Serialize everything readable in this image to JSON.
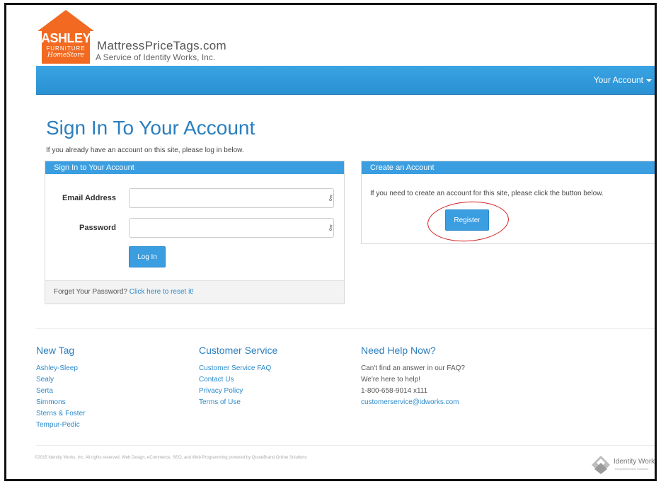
{
  "header": {
    "logo_main": "ASHLEY",
    "logo_sub": "FURNITURE",
    "logo_home": "HomeStore",
    "site_name": "MattressPriceTags.com",
    "site_tagline": "A Service of Identity Works, Inc."
  },
  "navbar": {
    "account_label": "Your Account",
    "color": "#3aa4e3"
  },
  "page": {
    "title": "Sign In To Your Account",
    "intro": "If you already have an account on this site, please log in below."
  },
  "sign_in_panel": {
    "heading": "Sign In to Your Account",
    "email_label": "Email Address",
    "email_value": "",
    "password_label": "Password",
    "password_value": "",
    "login_label": "Log In",
    "forgot_text": "Forget Your Password?",
    "forgot_link": "Click here to reset it!"
  },
  "create_panel": {
    "heading": "Create an Account",
    "text": "If you need to create an account for this site, please click the button below.",
    "register_label": "Register"
  },
  "footer": {
    "col1": {
      "heading": "New Tag",
      "links": [
        "Ashley-Sleep",
        "Sealy",
        "Serta",
        "Simmons",
        "Sterns & Foster",
        "Tempur-Pedic"
      ]
    },
    "col2": {
      "heading": "Customer Service",
      "links": [
        "Customer Service FAQ",
        "Contact Us",
        "Privacy Policy",
        "Terms of Use"
      ]
    },
    "col3": {
      "heading": "Need Help Now?",
      "lines": [
        "Can't find an answer in our FAQ?",
        "We're here to help!",
        "1-800-658-9014 x111"
      ],
      "email": "customerservice@idworks.com"
    },
    "copyright": "©2015 Identity Works, Inc. All rights reserved. Web Design, eCommerce, SEO, and Web Programming powered by QuoteBrand Online Solutions",
    "brand": "Identity Works",
    "brand_sub": "Integrated Brand Solutions"
  },
  "colors": {
    "accent": "#3a9ee0",
    "logo_orange": "#f26a21",
    "annotation": "#d62020"
  }
}
